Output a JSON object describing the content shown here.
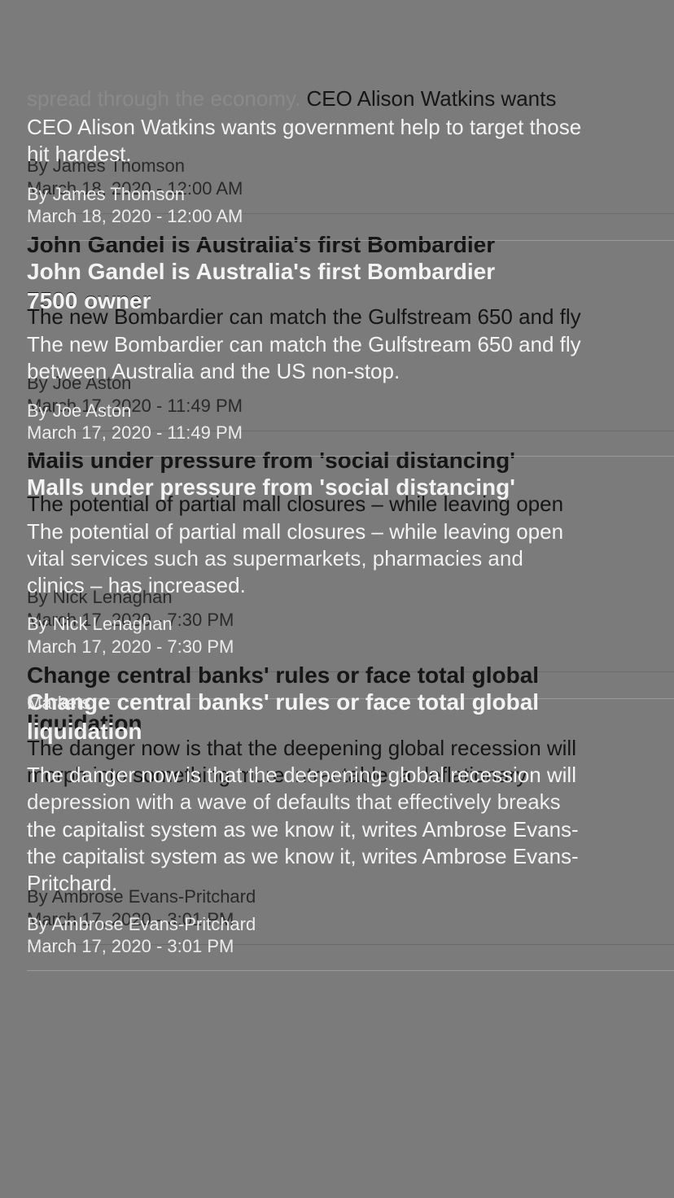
{
  "top_partial": {
    "faint_text": "spread through the economy.",
    "snippet_dark": "CEO Alison Watkins wants",
    "snippet_light_1": "CEO Alison Watkins wants government help to target those",
    "snippet_light_2": "hit hardest."
  },
  "articles": [
    {
      "title_line1": "John Gandel is Australia's first Bombardier",
      "title_line2": "7500 owner",
      "summary_lines": [
        "The new Bombardier can match the Gulfstream 650 and fly",
        "between Australia and the US non-stop."
      ],
      "author": "By Joe Aston",
      "date": "March 17, 2020 - 11:49 PM"
    },
    {
      "title_line1": "Malls under pressure from 'social distancing'",
      "title_line2": "",
      "summary_lines": [
        "The potential of partial mall closures – while leaving open",
        "vital services such as supermarkets, pharmacies and",
        "clinics – has increased."
      ],
      "author": "By Nick Lenaghan",
      "date": "March 17, 2020 - 7:30 PM"
    },
    {
      "title_line1": "Change central banks' rules or face total global",
      "title_line2": "liquidation",
      "summary_lines": [
        "The danger now is that the deepening global recession will",
        "morph into something more intractable: a deflationary",
        "depression with a wave of defaults that effectively breaks",
        "the capitalist system as we know it, writes Ambrose Evans-",
        "Pritchard."
      ],
      "author": "By Ambrose Evans-Pritchard",
      "date": "March 17, 2020 - 3:01 PM"
    }
  ],
  "first_meta": {
    "author": "By James Thomson",
    "date": "March 18, 2020 - 12:00 AM"
  },
  "ghost_text": "Markets"
}
